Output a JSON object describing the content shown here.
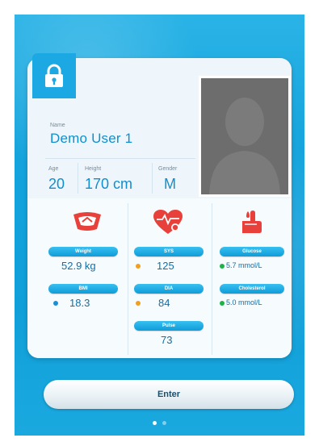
{
  "profile": {
    "name_label": "Name",
    "name": "Demo User 1",
    "age_label": "Age",
    "age": "20",
    "height_label": "Height",
    "height": "170 cm",
    "gender_label": "Gender",
    "gender": "M"
  },
  "metrics": {
    "scale": {
      "icon": "scale-icon",
      "weight_label": "Weight",
      "weight": "52.9 kg",
      "bmi_label": "BMI",
      "bmi": "18.3"
    },
    "heart": {
      "icon": "heart-pressure-icon",
      "sys_label": "SYS",
      "sys": "125",
      "dia_label": "DIA",
      "dia": "84",
      "pulse_label": "Pulse",
      "pulse": "73"
    },
    "blood": {
      "icon": "finger-drop-icon",
      "glucose_label": "Glucose",
      "glucose": "5.7 mmol/L",
      "cholesterol_label": "Cholesterol",
      "cholesterol": "5.0 mmol/L"
    }
  },
  "enter_label": "Enter",
  "pager": {
    "count": 2,
    "active": 1
  },
  "colors": {
    "accent": "#0f8fd0",
    "background": "#14a3dc",
    "status_green": "#1fb24a",
    "status_orange": "#f0a020",
    "status_blue": "#1a8fd8"
  }
}
